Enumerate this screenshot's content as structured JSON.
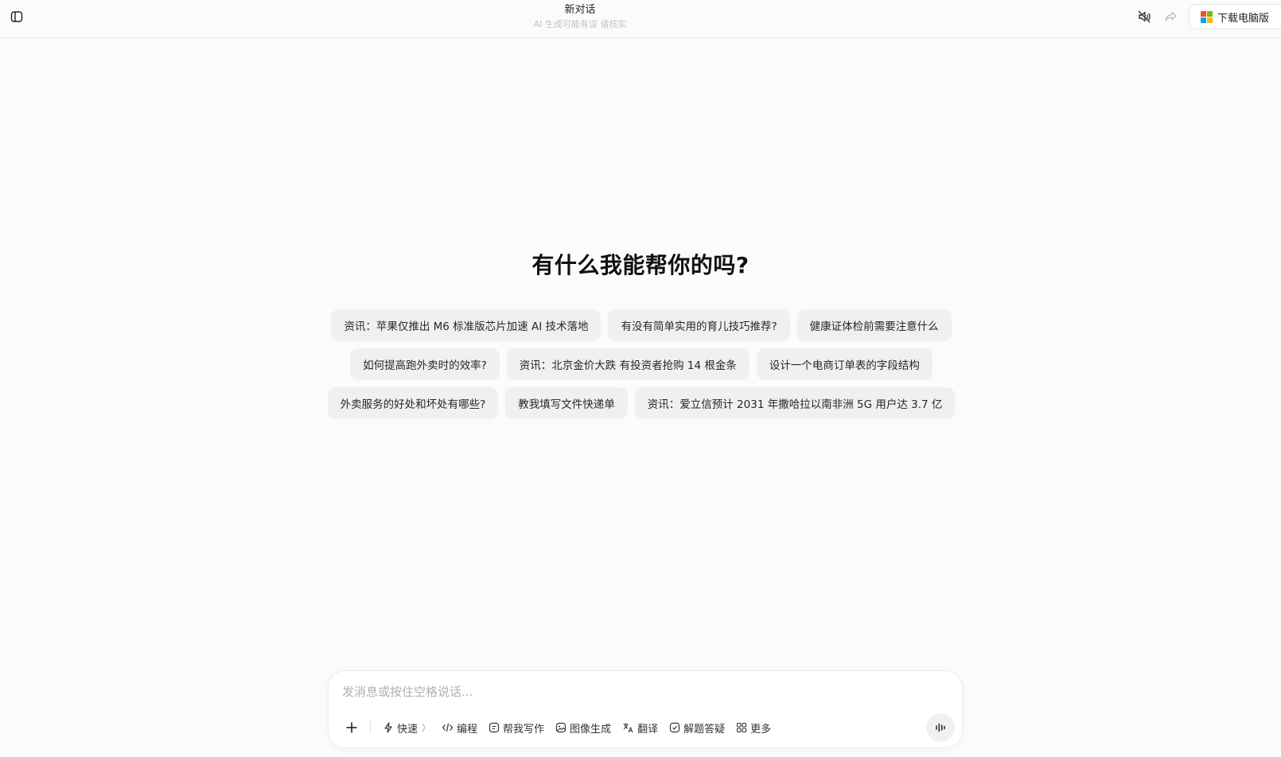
{
  "header": {
    "title": "新对话",
    "subtitle": "AI 生成可能有误 请核实",
    "download_label": "下载电脑版"
  },
  "main": {
    "heading": "有什么我能帮你的吗?",
    "suggestions": [
      [
        "资讯：苹果仅推出 M6 标准版芯片加速 AI 技术落地",
        "有没有简单实用的育儿技巧推荐?",
        "健康证体检前需要注意什么"
      ],
      [
        "如何提高跑外卖时的效率?",
        "资讯：北京金价大跌 有投资者抢购 14 根金条",
        "设计一个电商订单表的字段结构"
      ],
      [
        "外卖服务的好处和坏处有哪些?",
        "教我填写文件快递单",
        "资讯：爱立信预计 2031 年撒哈拉以南非洲 5G 用户达 3.7 亿"
      ]
    ]
  },
  "composer": {
    "placeholder": "发消息或按住空格说话...",
    "value": "",
    "tools": {
      "fast": "快速",
      "code": "编程",
      "write": "帮我写作",
      "image": "图像生成",
      "translate": "翻译",
      "solve": "解题答疑",
      "more": "更多"
    }
  },
  "icons": {
    "sidebar": "sidebar-toggle-icon",
    "mute": "speaker-muted-icon",
    "share": "share-arrow-icon",
    "plus": "plus-icon",
    "voice": "voice-wave-icon"
  },
  "colors": {
    "background": "#fbfbfb",
    "chip": "#f0f0f0",
    "ms_red": "#f25022",
    "ms_green": "#7fba00",
    "ms_blue": "#00a4ef",
    "ms_yellow": "#ffb900"
  }
}
